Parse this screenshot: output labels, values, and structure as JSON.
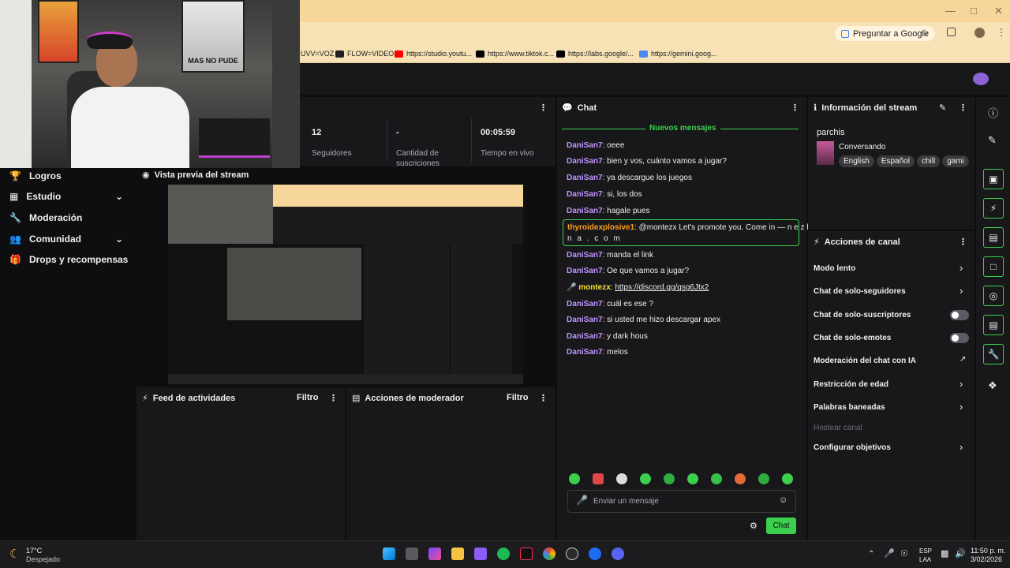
{
  "browser": {
    "ask_google": "Preguntar a Google",
    "bookmarks": [
      "UVV=VOZ",
      "FLOW=VIDEO",
      "https://studio.youtu...",
      "https://www.tiktok.c...",
      "https://labs.google/...",
      "https://gemini.goog..."
    ]
  },
  "webcam": {
    "poster_text": "MAS NO PUDE"
  },
  "nav": {
    "items": [
      {
        "label": "Logros"
      },
      {
        "label": "Estudio"
      },
      {
        "label": "Moderación"
      },
      {
        "label": "Comunidad"
      },
      {
        "label": "Drops y recompensas"
      }
    ]
  },
  "stats": [
    {
      "value": "12",
      "label": "Seguidores"
    },
    {
      "value": "-",
      "label": "Cantidad de suscriciones"
    },
    {
      "value": "00:05:59",
      "label": "Tiempo en vivo"
    }
  ],
  "preview": {
    "title": "Vista previa del stream"
  },
  "feed": {
    "title": "Feed de actividades",
    "filter": "Filtro"
  },
  "modactions": {
    "title": "Acciones de moderador",
    "filter": "Filtro"
  },
  "chat": {
    "title": "Chat",
    "new_messages": "Nuevos mensajes",
    "messages": [
      {
        "user": "DaniSan7",
        "text": "oeee"
      },
      {
        "user": "DaniSan7",
        "text": "bien y vos, cuánto vamos a jugar?"
      },
      {
        "user": "DaniSan7",
        "text": "ya descargue los juegos"
      },
      {
        "user": "DaniSan7",
        "text": "si, los dos"
      },
      {
        "user": "DaniSan7",
        "text": "hagale pues"
      },
      {
        "user": "thyroidexplosive1",
        "text": "@montezx Let's promote you. Come in — n e z h",
        "text2": "n a . c o m"
      },
      {
        "user": "DaniSan7",
        "text": "manda el link"
      },
      {
        "user": "DaniSan7",
        "text": "Oe que vamos a jugar?"
      },
      {
        "user": "montezx",
        "text": "https://discord.gg/qsg6Jtx2"
      },
      {
        "user": "DaniSan7",
        "text": "cuál es ese ?"
      },
      {
        "user": "DaniSan7",
        "text": "si usted me hizo descargar apex"
      },
      {
        "user": "DaniSan7",
        "text": "y dark hous"
      },
      {
        "user": "DaniSan7",
        "text": "melos"
      }
    ],
    "input_placeholder": "Enviar un mensaje",
    "send_label": "Chat"
  },
  "stream_info": {
    "title": "Información del stream",
    "stream_title": "parchis",
    "category": "Conversando",
    "tags": [
      "English",
      "Español",
      "chill",
      "gami"
    ]
  },
  "channel_actions": {
    "title": "Acciones de canal",
    "items": [
      {
        "label": "Modo lento"
      },
      {
        "label": "Chat de solo-seguidores"
      },
      {
        "label": "Chat de solo-suscriptores"
      },
      {
        "label": "Chat de solo-emotes"
      },
      {
        "label": "Moderación del chat con IA"
      },
      {
        "label": "Restricción de edad"
      },
      {
        "label": "Palabras baneadas"
      },
      {
        "label": "Hostear canal"
      },
      {
        "label": "Configurar objetivos"
      }
    ]
  },
  "taskbar": {
    "weather_temp": "17°C",
    "weather_desc": "Despejado",
    "lang": "ESP",
    "lang2": "LAA",
    "time": "11:50 p. m.",
    "date": "3/02/2026"
  }
}
